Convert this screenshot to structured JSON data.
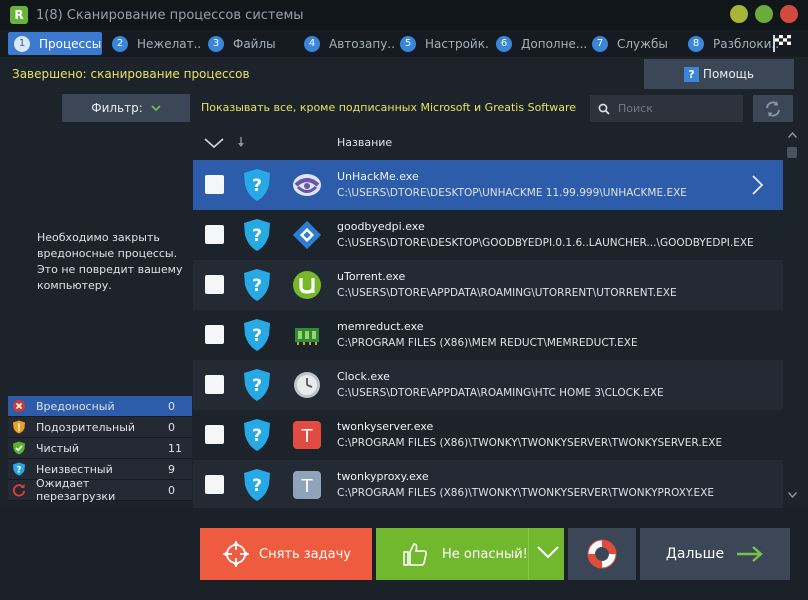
{
  "window": {
    "title": "1(8) Сканирование процессов системы",
    "logo_letter": "R",
    "buttons": [
      "minimize-button",
      "maximize-button",
      "close-button"
    ]
  },
  "steps": [
    {
      "num": "1",
      "label": "Процессы",
      "active": true
    },
    {
      "num": "2",
      "label": "Нежелат..."
    },
    {
      "num": "3",
      "label": "Файлы"
    },
    {
      "num": "4",
      "label": "Автозапу..."
    },
    {
      "num": "5",
      "label": "Настройк..."
    },
    {
      "num": "6",
      "label": "Дополне..."
    },
    {
      "num": "7",
      "label": "Службы"
    },
    {
      "num": "8",
      "label": "Разблоки..."
    }
  ],
  "status": "Завершено: сканирование процессов",
  "help_label": "Помощь",
  "help_icon_glyph": "?",
  "filter": {
    "label": "Фильтр:",
    "description": "Показывать все, кроме подписанных Microsoft и Greatis Software"
  },
  "search": {
    "placeholder": "Поиск",
    "value": ""
  },
  "notice": "Необходимо закрыть вредоносные процессы. Это не повредит вашему компьютеру.",
  "legend": [
    {
      "label": "Вредоносный",
      "count": "0",
      "icon": "red-x-icon"
    },
    {
      "label": "Подозрительный",
      "count": "0",
      "icon": "orange-exclamation-shield-icon"
    },
    {
      "label": "Чистый",
      "count": "11",
      "icon": "green-check-shield-icon"
    },
    {
      "label": "Неизвестный",
      "count": "9",
      "icon": "blue-question-shield-icon"
    },
    {
      "label": "Ожидает перезагрузки",
      "count": "0",
      "icon": "red-restart-icon"
    }
  ],
  "table": {
    "column_name": "Название",
    "rows": [
      {
        "name": "UnHackMe.exe",
        "path": "C:\\USERS\\DTORE\\DESKTOP\\UNHACKME 11.99.999\\UNHACKME.EXE",
        "icon": "unhackme-icon",
        "selected": true
      },
      {
        "name": "goodbyedpi.exe",
        "path": "C:\\USERS\\DTORE\\DESKTOP\\GOODBYEDPI.0.1.6..LAUNCHER...\\GOODBYEDPI.EXE",
        "icon": "goodbyedpi-icon"
      },
      {
        "name": "uTorrent.exe",
        "path": "C:\\USERS\\DTORE\\APPDATA\\ROAMING\\UTORRENT\\UTORRENT.EXE",
        "icon": "utorrent-icon"
      },
      {
        "name": "memreduct.exe",
        "path": "C:\\PROGRAM FILES (X86)\\MEM REDUCT\\MEMREDUCT.EXE",
        "icon": "memreduct-icon"
      },
      {
        "name": "Clock.exe",
        "path": "C:\\USERS\\DTORE\\APPDATA\\ROAMING\\HTC HOME 3\\CLOCK.EXE",
        "icon": "clock-icon"
      },
      {
        "name": "twonkyserver.exe",
        "path": "C:\\PROGRAM FILES (X86)\\TWONKY\\TWONKYSERVER\\TWONKYSERVER.EXE",
        "icon": "twonkyserver-icon",
        "icon_letter": "T"
      },
      {
        "name": "twonkyproxy.exe",
        "path": "C:\\PROGRAM FILES (X86)\\TWONKY\\TWONKYSERVER\\TWONKYPROXY.EXE",
        "icon": "twonkyproxy-icon",
        "icon_letter": "T"
      }
    ]
  },
  "buttons": {
    "kill": "Снять задачу",
    "safe": "Не опасный!",
    "next": "Дальше"
  },
  "colors": {
    "accent_blue": "#3a7ad0",
    "selected_row": "#2d5cab",
    "status_yellow": "#e8e264",
    "kill_orange": "#ef5b3e",
    "safe_green": "#72b82e",
    "shield_blue": "#27a9e6"
  }
}
